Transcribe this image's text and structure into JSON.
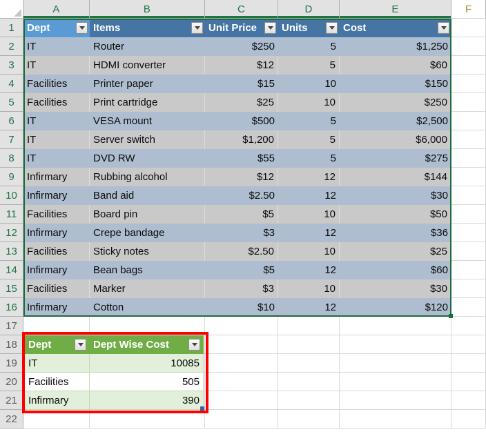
{
  "app": "spreadsheet",
  "grid": {
    "column_headers": [
      "A",
      "B",
      "C",
      "D",
      "E",
      "F"
    ],
    "row_headers": [
      "1",
      "2",
      "3",
      "4",
      "5",
      "6",
      "7",
      "8",
      "9",
      "10",
      "11",
      "12",
      "13",
      "14",
      "15",
      "16",
      "17",
      "18",
      "19",
      "20",
      "21",
      "22"
    ],
    "selected_columns": [
      "A",
      "B",
      "C",
      "D",
      "E"
    ],
    "colors": {
      "header_text_selected": "#217346",
      "header_fill": "#E2E2E2",
      "gridline": "#D9D9D9",
      "selection_border": "#1E6B3C",
      "blue_table_header": "#4575A5",
      "blue_table_active_cell": "#5B9BD5",
      "blue_band": "#AEBDD0",
      "gray_band": "#C9C9C9",
      "green_table_header": "#70AD47",
      "green_band": "#E2EFDA",
      "highlight_box": "#FF0000"
    }
  },
  "blue_table": {
    "name": "items-cost-table",
    "columns": [
      "Dept",
      "Items",
      "Unit Price",
      "Units",
      "Cost"
    ],
    "filter_icon": "filter-dropdown-icon",
    "active_header": "Dept",
    "rows": [
      {
        "dept": "IT",
        "item": "Router",
        "unit_price": "$250",
        "units": "5",
        "cost": "$1,250"
      },
      {
        "dept": "IT",
        "item": "HDMI converter",
        "unit_price": "$12",
        "units": "5",
        "cost": "$60"
      },
      {
        "dept": "Facilities",
        "item": "Printer paper",
        "unit_price": "$15",
        "units": "10",
        "cost": "$150"
      },
      {
        "dept": "Facilities",
        "item": "Print cartridge",
        "unit_price": "$25",
        "units": "10",
        "cost": "$250"
      },
      {
        "dept": "IT",
        "item": "VESA mount",
        "unit_price": "$500",
        "units": "5",
        "cost": "$2,500"
      },
      {
        "dept": "IT",
        "item": "Server switch",
        "unit_price": "$1,200",
        "units": "5",
        "cost": "$6,000"
      },
      {
        "dept": "IT",
        "item": "DVD RW",
        "unit_price": "$55",
        "units": "5",
        "cost": "$275"
      },
      {
        "dept": "Infirmary",
        "item": "Rubbing alcohol",
        "unit_price": "$12",
        "units": "12",
        "cost": "$144"
      },
      {
        "dept": "Infirmary",
        "item": "Band aid",
        "unit_price": "$2.50",
        "units": "12",
        "cost": "$30"
      },
      {
        "dept": "Facilities",
        "item": "Board pin",
        "unit_price": "$5",
        "units": "10",
        "cost": "$50"
      },
      {
        "dept": "Infirmary",
        "item": "Crepe bandage",
        "unit_price": "$3",
        "units": "12",
        "cost": "$36"
      },
      {
        "dept": "Facilities",
        "item": "Sticky notes",
        "unit_price": "$2.50",
        "units": "10",
        "cost": "$25"
      },
      {
        "dept": "Infirmary",
        "item": "Bean bags",
        "unit_price": "$5",
        "units": "12",
        "cost": "$60"
      },
      {
        "dept": "Facilities",
        "item": "Marker",
        "unit_price": "$3",
        "units": "10",
        "cost": "$30"
      },
      {
        "dept": "Infirmary",
        "item": "Cotton",
        "unit_price": "$10",
        "units": "12",
        "cost": "$120"
      }
    ]
  },
  "green_table": {
    "name": "dept-wise-cost-table",
    "columns": [
      "Dept",
      "Dept Wise Cost"
    ],
    "filter_icon": "filter-dropdown-icon",
    "rows": [
      {
        "dept": "IT",
        "cost": "10085"
      },
      {
        "dept": "Facilities",
        "cost": "505"
      },
      {
        "dept": "Infirmary",
        "cost": "390"
      }
    ]
  }
}
